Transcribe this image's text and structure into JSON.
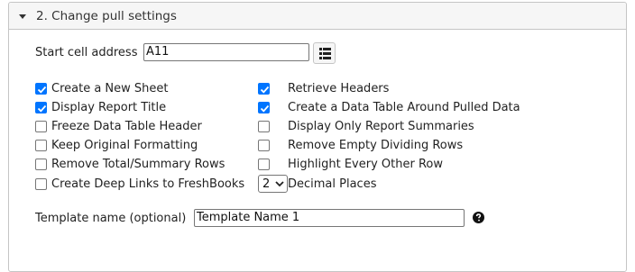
{
  "section": {
    "title": "2. Change pull settings",
    "expanded": true
  },
  "start_cell": {
    "label": "Start cell address",
    "value": "A11",
    "picker_icon": "table-grid-icon"
  },
  "options_left": [
    {
      "label": "Create a New Sheet",
      "checked": true
    },
    {
      "label": "Display Report Title",
      "checked": true
    },
    {
      "label": "Freeze Data Table Header",
      "checked": false
    },
    {
      "label": "Keep Original Formatting",
      "checked": false
    },
    {
      "label": "Remove Total/Summary Rows",
      "checked": false
    },
    {
      "label": "Create Deep Links to FreshBooks",
      "checked": false
    }
  ],
  "options_right": [
    {
      "label": "Retrieve Headers",
      "checked": true
    },
    {
      "label": "Create a Data Table Around Pulled Data",
      "checked": true
    },
    {
      "label": "Display Only Report Summaries",
      "checked": false
    },
    {
      "label": "Remove Empty Dividing Rows",
      "checked": false
    },
    {
      "label": "Highlight Every Other Row",
      "checked": false
    }
  ],
  "decimal_places": {
    "value": "2",
    "label": "Decimal Places"
  },
  "template": {
    "label": "Template name (optional)",
    "value": "Template Name 1",
    "help_icon": "question-circle-icon"
  },
  "colors": {
    "checkbox_checked": "#0075ff",
    "header_bg": "#f6f6f6",
    "border": "#c5c5c5"
  }
}
